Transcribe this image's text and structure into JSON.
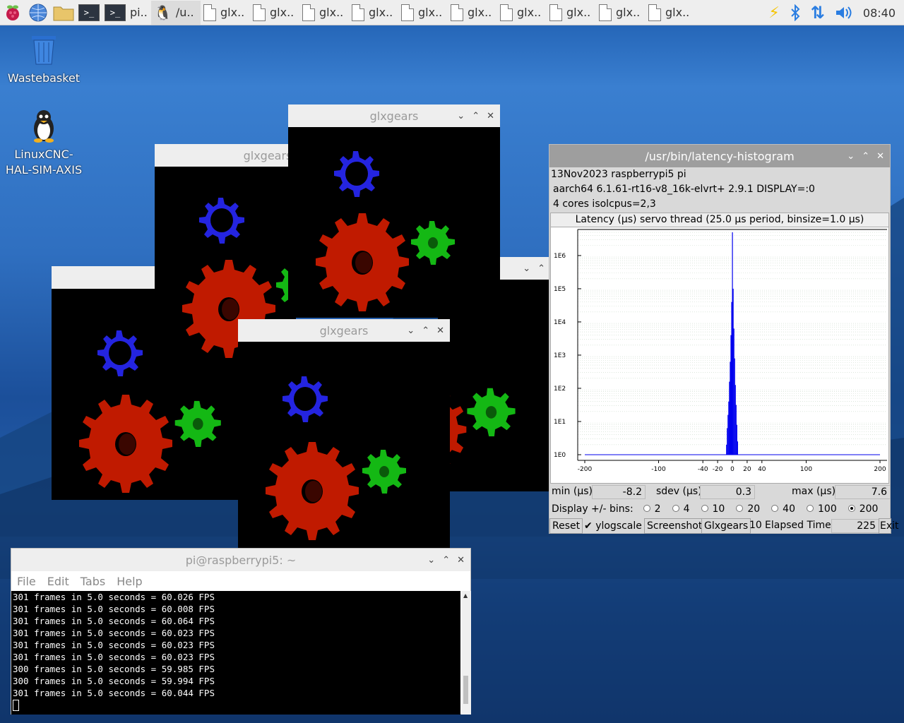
{
  "taskbar": {
    "launchers": [
      "raspberry-menu-icon",
      "web-browser-icon",
      "file-manager-icon",
      "terminal-icon"
    ],
    "tasks": [
      {
        "label": "pi..",
        "icon": "terminal-icon",
        "active": false
      },
      {
        "label": "/u..",
        "icon": "linuxcnc-icon",
        "active": true
      },
      {
        "label": "glx..",
        "icon": "document-icon"
      },
      {
        "label": "glx..",
        "icon": "document-icon"
      },
      {
        "label": "glx..",
        "icon": "document-icon"
      },
      {
        "label": "glx..",
        "icon": "document-icon"
      },
      {
        "label": "glx..",
        "icon": "document-icon"
      },
      {
        "label": "glx..",
        "icon": "document-icon"
      },
      {
        "label": "glx..",
        "icon": "document-icon"
      },
      {
        "label": "glx..",
        "icon": "document-icon"
      },
      {
        "label": "glx..",
        "icon": "document-icon"
      },
      {
        "label": "glx..",
        "icon": "document-icon"
      }
    ],
    "clock": "08:40"
  },
  "desktop": {
    "wastebasket": "Wastebasket",
    "linuxcnc_line1": "LinuxCNC-",
    "linuxcnc_line2": "HAL-SIM-AXIS"
  },
  "glxgears": {
    "title": "glxgears",
    "title_partial1": "glxgears",
    "title_partial2": "glx"
  },
  "histogram": {
    "title": "/usr/bin/latency-histogram",
    "info1": "13Nov2023 raspberrypi5 pi",
    "info2": "aarch64  6.1.61-rt16-v8_16k-elvrt+  2.9.1  DISPLAY=:0",
    "info3": "4 cores  isolcpus=2,3",
    "min_label": "min (µs)",
    "min": "-8.2",
    "sdev_label": "sdev (µs)",
    "sdev": "0.3",
    "max_label": "max (µs)",
    "max": "7.6",
    "display_label": "Display +/- bins:",
    "bins": [
      {
        "v": "2",
        "on": false
      },
      {
        "v": "4",
        "on": false
      },
      {
        "v": "10",
        "on": false
      },
      {
        "v": "20",
        "on": false
      },
      {
        "v": "40",
        "on": false
      },
      {
        "v": "100",
        "on": false
      },
      {
        "v": "200",
        "on": true
      }
    ],
    "reset": "Reset",
    "ylogscale": "ylogscale",
    "screenshot": "Screenshot",
    "glxgears_btn": "Glxgears",
    "glxgears_count": "10",
    "elapsed_label": "Elapsed Time:",
    "elapsed": "225",
    "exit": "Exit"
  },
  "chart_data": {
    "type": "bar",
    "title": "Latency (µs) servo thread (25.0 µs period, binsize=1.0 µs)",
    "x_ticks": [
      "-200",
      "-100",
      "-40",
      "-20",
      "0",
      "20",
      "40",
      "100",
      "200"
    ],
    "x_tick_values": [
      -200,
      -100,
      -40,
      -20,
      0,
      20,
      40,
      100,
      200
    ],
    "y_ticks": [
      "1E6",
      "1E5",
      "1E4",
      "1E3",
      "1E2",
      "1E1",
      "1E0"
    ],
    "y_tick_values": [
      6,
      5,
      4,
      3,
      2,
      1,
      0
    ],
    "yscale": "log",
    "xlim": [
      -200,
      200
    ],
    "ylim_log10": [
      0,
      6.7
    ],
    "x": [
      -8,
      -7,
      -6,
      -5,
      -4,
      -3,
      -2,
      -1,
      0,
      1,
      2,
      3,
      4,
      5,
      6,
      7
    ],
    "log10_counts": [
      0.3,
      0.8,
      1.2,
      1.6,
      2.2,
      2.8,
      3.6,
      4.6,
      6.7,
      5.0,
      3.8,
      2.9,
      2.1,
      1.5,
      0.9,
      0.4
    ],
    "color": "#0000ee",
    "grid": true
  },
  "terminal": {
    "title": "pi@raspberrypi5: ~",
    "menu": [
      "File",
      "Edit",
      "Tabs",
      "Help"
    ],
    "lines": [
      "301 frames in 5.0 seconds = 60.026 FPS",
      "301 frames in 5.0 seconds = 60.008 FPS",
      "301 frames in 5.0 seconds = 60.064 FPS",
      "301 frames in 5.0 seconds = 60.023 FPS",
      "301 frames in 5.0 seconds = 60.023 FPS",
      "301 frames in 5.0 seconds = 60.023 FPS",
      "300 frames in 5.0 seconds = 59.985 FPS",
      "300 frames in 5.0 seconds = 59.994 FPS",
      "301 frames in 5.0 seconds = 60.044 FPS"
    ]
  }
}
